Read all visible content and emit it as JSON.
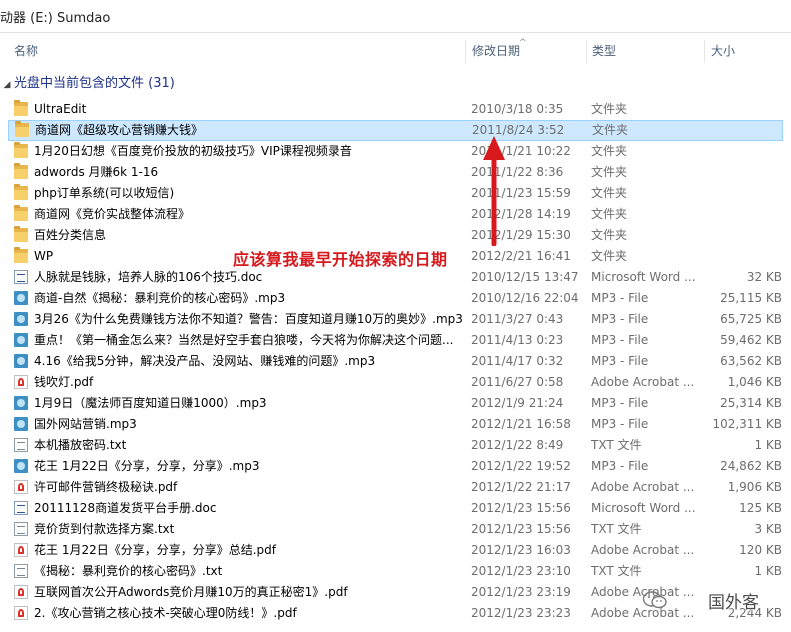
{
  "title_bar": {
    "text": "动器 (E:) Sumdao"
  },
  "columns": {
    "name": "名称",
    "date": "修改日期",
    "type": "类型",
    "size": "大小"
  },
  "group": {
    "label": "光盘中当前包含的文件 (31)"
  },
  "files": [
    {
      "icon": "folder",
      "name": "UltraEdit",
      "date": "2010/3/18 0:35",
      "type": "文件夹",
      "size": ""
    },
    {
      "icon": "folder",
      "name": "商道网《超级攻心营销赚大钱》",
      "date": "2011/8/24 3:52",
      "type": "文件夹",
      "size": "",
      "selected": true
    },
    {
      "icon": "folder",
      "name": "1月20日幻想《百度竞价投放的初级技巧》VIP课程视频录音",
      "date": "2011/1/21 10:22",
      "type": "文件夹",
      "size": ""
    },
    {
      "icon": "folder",
      "name": "adwords 月赚6k 1-16",
      "date": "2011/1/22 8:36",
      "type": "文件夹",
      "size": ""
    },
    {
      "icon": "folder",
      "name": "php订单系统(可以收短信)",
      "date": "2011/1/23 15:59",
      "type": "文件夹",
      "size": ""
    },
    {
      "icon": "folder",
      "name": "商道网《竞价实战整体流程》",
      "date": "2012/1/28 14:19",
      "type": "文件夹",
      "size": ""
    },
    {
      "icon": "folder",
      "name": "百姓分类信息",
      "date": "2012/1/29 15:30",
      "type": "文件夹",
      "size": ""
    },
    {
      "icon": "folder",
      "name": "WP",
      "date": "2012/2/21 16:41",
      "type": "文件夹",
      "size": ""
    },
    {
      "icon": "doc",
      "name": "人脉就是钱脉，培养人脉的106个技巧.doc",
      "date": "2010/12/15 13:47",
      "type": "Microsoft Word ...",
      "size": "32 KB"
    },
    {
      "icon": "mp3",
      "name": "商道-自然《揭秘：暴利竞价的核心密码》.mp3",
      "date": "2010/12/16 22:04",
      "type": "MP3 - File",
      "size": "25,115 KB"
    },
    {
      "icon": "mp3",
      "name": "3月26《为什么免费赚钱方法你不知道？警告：百度知道月赚10万的奥妙》.mp3",
      "date": "2011/3/27 0:43",
      "type": "MP3 - File",
      "size": "65,725 KB"
    },
    {
      "icon": "mp3",
      "name": "重点！《第一桶金怎么来？当然是好空手套白狼喽，今天将为你解决这个问题...",
      "date": "2011/4/13 0:23",
      "type": "MP3 - File",
      "size": "59,462 KB"
    },
    {
      "icon": "mp3",
      "name": "4.16《给我5分钟，解决没产品、没网站、赚钱难的问题》.mp3",
      "date": "2011/4/17 0:32",
      "type": "MP3 - File",
      "size": "63,562 KB"
    },
    {
      "icon": "pdf",
      "name": "钱吹灯.pdf",
      "date": "2011/6/27 0:58",
      "type": "Adobe Acrobat ...",
      "size": "1,046 KB"
    },
    {
      "icon": "mp3",
      "name": "1月9日（魔法师百度知道日赚1000）.mp3",
      "date": "2012/1/9 21:24",
      "type": "MP3 - File",
      "size": "25,314 KB"
    },
    {
      "icon": "mp3",
      "name": "国外网站营销.mp3",
      "date": "2012/1/21 16:58",
      "type": "MP3 - File",
      "size": "102,311 KB"
    },
    {
      "icon": "txt",
      "name": "本机播放密码.txt",
      "date": "2012/1/22 8:49",
      "type": "TXT 文件",
      "size": "1 KB"
    },
    {
      "icon": "mp3",
      "name": "花王 1月22日《分享，分享，分享》.mp3",
      "date": "2012/1/22 19:52",
      "type": "MP3 - File",
      "size": "24,862 KB"
    },
    {
      "icon": "pdf",
      "name": "许可邮件营销终极秘诀.pdf",
      "date": "2012/1/22 21:17",
      "type": "Adobe Acrobat ...",
      "size": "1,906 KB"
    },
    {
      "icon": "doc",
      "name": "20111128商道发货平台手册.doc",
      "date": "2012/1/23 15:56",
      "type": "Microsoft Word ...",
      "size": "125 KB"
    },
    {
      "icon": "txt",
      "name": "竞价货到付款选择方案.txt",
      "date": "2012/1/23 15:56",
      "type": "TXT 文件",
      "size": "3 KB"
    },
    {
      "icon": "pdf",
      "name": "花王 1月22日《分享，分享，分享》总结.pdf",
      "date": "2012/1/23 16:03",
      "type": "Adobe Acrobat ...",
      "size": "120 KB"
    },
    {
      "icon": "txt",
      "name": "《揭秘：暴利竞价的核心密码》.txt",
      "date": "2012/1/23 23:10",
      "type": "TXT 文件",
      "size": "1 KB"
    },
    {
      "icon": "pdf",
      "name": "互联网首次公开Adwords竞价月赚10万的真正秘密1》.pdf",
      "date": "2012/1/23 23:19",
      "type": "Adobe Acrobat ...",
      "size": ""
    },
    {
      "icon": "pdf",
      "name": "2.《攻心营销之核心技术-突破心理0防线！》.pdf",
      "date": "2012/1/23 23:23",
      "type": "Adobe Acrobat ...",
      "size": "2,244 KB"
    }
  ],
  "annotation": {
    "text": "应该算我最早开始探索的日期",
    "color": "#d7191d"
  },
  "watermark": {
    "text": "国外客",
    "icon": "wechat-icon"
  },
  "colors": {
    "selection_bg": "#cde8ff",
    "selection_border": "#99d1ff",
    "group_header": "#1e3287"
  }
}
